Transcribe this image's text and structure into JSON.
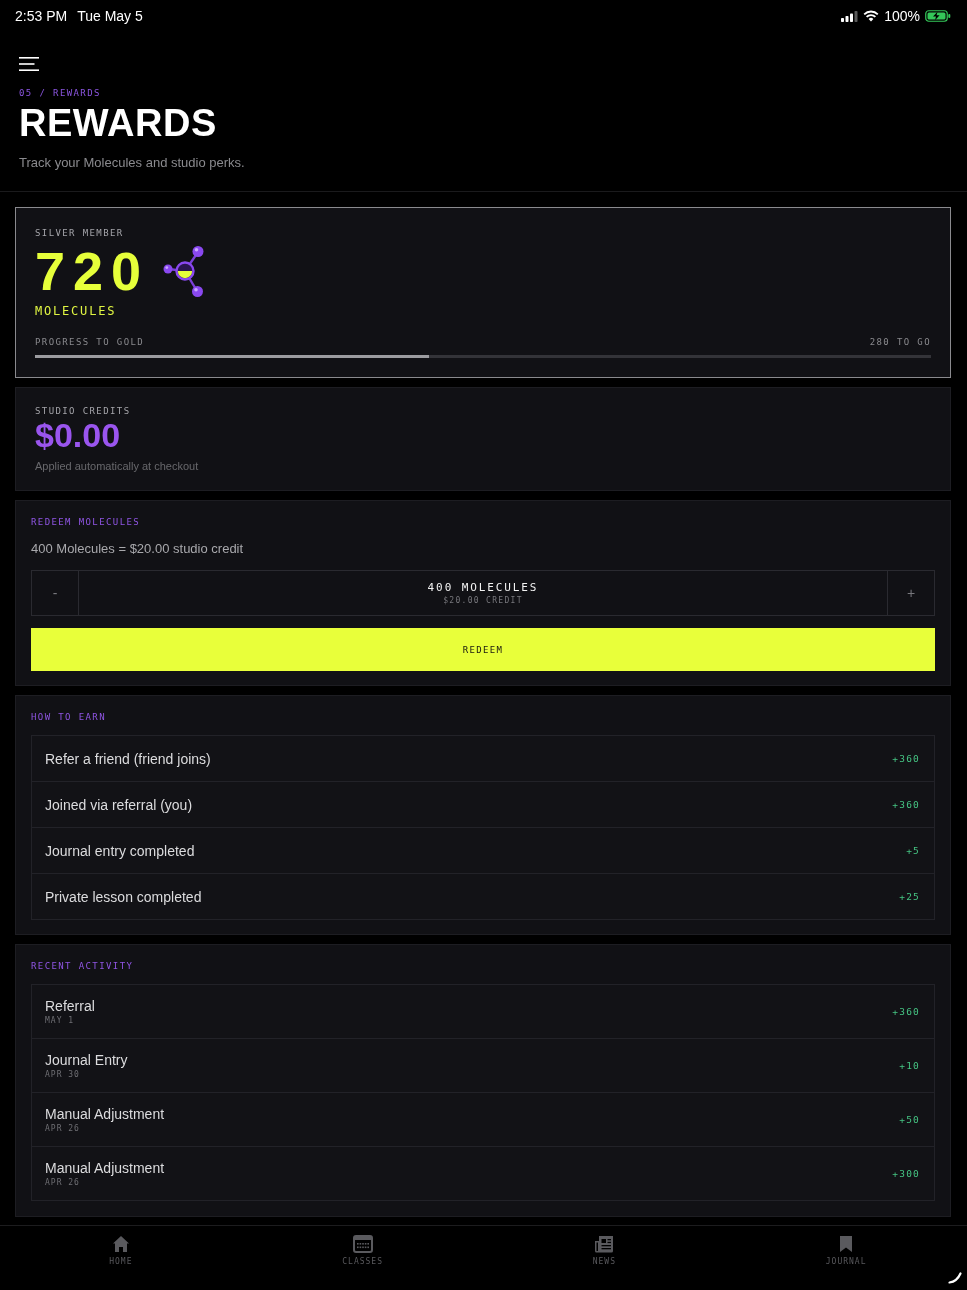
{
  "status_bar": {
    "time": "2:53 PM",
    "date": "Tue May 5",
    "battery": "100%",
    "charging": true
  },
  "header": {
    "breadcrumb": "05 / REWARDS",
    "title": "REWARDS",
    "subtitle": "Track your Molecules and studio perks."
  },
  "membership": {
    "tier": "SILVER MEMBER",
    "points": "720",
    "unit": "MOLECULES",
    "progress_label": "PROGRESS TO GOLD",
    "remaining": "280 TO GO",
    "level": 0.44
  },
  "credits": {
    "label": "STUDIO CREDITS",
    "amount": "$0.00",
    "note": "Applied automatically at checkout"
  },
  "redeem": {
    "heading": "REDEEM MOLECULES",
    "rate": "400 Molecules = $20.00 studio credit",
    "decrement": "-",
    "amount": "400 MOLECULES",
    "value": "$20.00 CREDIT",
    "increment": "+",
    "button": "REDEEM"
  },
  "how_to_earn": {
    "heading": "HOW TO EARN",
    "items": [
      {
        "label": "Refer a friend (friend joins)",
        "points": "+360"
      },
      {
        "label": "Joined via referral (you)",
        "points": "+360"
      },
      {
        "label": "Journal entry completed",
        "points": "+5"
      },
      {
        "label": "Private lesson completed",
        "points": "+25"
      }
    ]
  },
  "recent_activity": {
    "heading": "RECENT ACTIVITY",
    "items": [
      {
        "title": "Referral",
        "date": "MAY 1",
        "points": "+360"
      },
      {
        "title": "Journal Entry",
        "date": "APR 30",
        "points": "+10"
      },
      {
        "title": "Manual Adjustment",
        "date": "APR 26",
        "points": "+50"
      },
      {
        "title": "Manual Adjustment",
        "date": "APR 26",
        "points": "+300"
      }
    ]
  },
  "tab_bar": {
    "items": [
      {
        "kind": "home",
        "label": "HOME"
      },
      {
        "kind": "classes",
        "label": "CLASSES"
      },
      {
        "kind": "news",
        "label": "NEWS"
      },
      {
        "kind": "journal",
        "label": "JOURNAL"
      }
    ]
  }
}
